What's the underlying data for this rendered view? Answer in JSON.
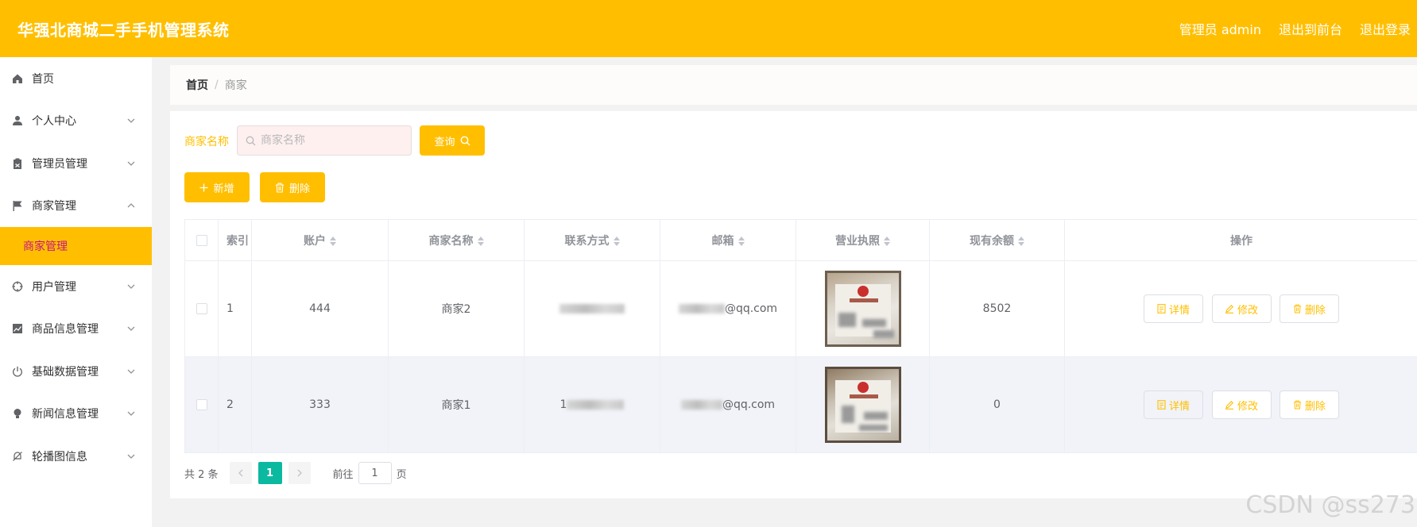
{
  "app": {
    "title": "华强北商城二手手机管理系统",
    "admin_text": "管理员 admin",
    "to_front": "退出到前台",
    "logout": "退出登录"
  },
  "sidebar": {
    "items": [
      {
        "label": "首页",
        "icon": "home-icon"
      },
      {
        "label": "个人中心",
        "icon": "user-icon"
      },
      {
        "label": "管理员管理",
        "icon": "clipboard-icon"
      },
      {
        "label": "商家管理",
        "icon": "flag-icon"
      },
      {
        "label": "用户管理",
        "icon": "target-icon"
      },
      {
        "label": "商品信息管理",
        "icon": "chart-icon"
      },
      {
        "label": "基础数据管理",
        "icon": "power-icon"
      },
      {
        "label": "新闻信息管理",
        "icon": "bulb-icon"
      },
      {
        "label": "轮播图信息",
        "icon": "bell-off-icon"
      }
    ],
    "active_sub": "商家管理"
  },
  "breadcrumb": {
    "home": "首页",
    "separator": "/",
    "current": "商家"
  },
  "search": {
    "label": "商家名称",
    "placeholder": "商家名称",
    "button": "查询"
  },
  "actions": {
    "add": "新增",
    "delete": "删除"
  },
  "table": {
    "headers": [
      "索引",
      "账户",
      "商家名称",
      "联系方式",
      "邮箱",
      "营业执照",
      "现有余额",
      "操作"
    ],
    "rows": [
      {
        "index": "1",
        "account": "444",
        "name": "商家2",
        "phone": "",
        "email_suffix": "@qq.com",
        "balance": "8502"
      },
      {
        "index": "2",
        "account": "333",
        "name": "商家1",
        "phone": "1",
        "email_suffix": "@qq.com",
        "balance": "0"
      }
    ],
    "ops": {
      "detail": "详情",
      "edit": "修改",
      "delete": "删除"
    }
  },
  "pager": {
    "total": "共 2 条",
    "current": "1",
    "goto": "前往",
    "goto_value": "1",
    "page": "页"
  },
  "watermark": "CSDN @ss273",
  "colors": {
    "accent": "#ffbf00",
    "pager_active": "#0bb9a0",
    "sub_text": "#c71585"
  }
}
